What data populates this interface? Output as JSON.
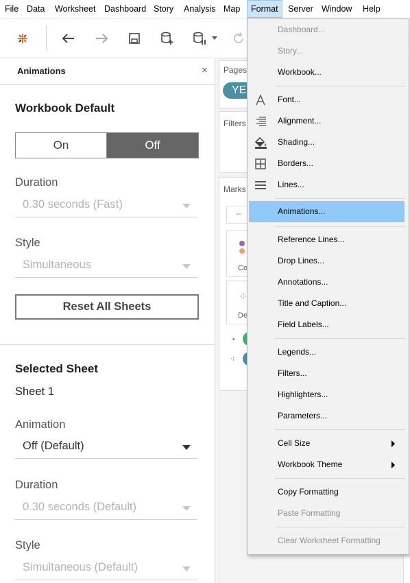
{
  "menubar": {
    "items": [
      {
        "label": "File"
      },
      {
        "label": "Data"
      },
      {
        "label": "Worksheet"
      },
      {
        "label": "Dashboard"
      },
      {
        "label": "Story"
      },
      {
        "label": "Analysis"
      },
      {
        "label": "Map"
      },
      {
        "label": "Format"
      },
      {
        "label": "Server"
      },
      {
        "label": "Window"
      },
      {
        "label": "Help"
      }
    ]
  },
  "toolbar": {
    "icons": [
      "tableau-logo-icon",
      "back-arrow-icon",
      "forward-arrow-icon",
      "save-icon",
      "new-datasource-icon",
      "pause-updates-icon",
      "dropdown-caret-icon",
      "refresh-icon"
    ]
  },
  "panel": {
    "title": "Animations",
    "close_glyph": "×",
    "workbook_default": {
      "heading": "Workbook Default",
      "toggle_on": "On",
      "toggle_off": "Off",
      "toggle_selected": "Off",
      "duration_label": "Duration",
      "duration_value": "0.30 seconds (Fast)",
      "style_label": "Style",
      "style_value": "Simultaneous",
      "reset_label": "Reset All Sheets"
    },
    "selected_sheet": {
      "heading": "Selected Sheet",
      "sheet_name": "Sheet 1",
      "animation_label": "Animation",
      "animation_value": "Off (Default)",
      "duration_label": "Duration",
      "duration_value": "0.30 seconds (Default)",
      "style_label": "Style",
      "style_value": "Simultaneous (Default)"
    }
  },
  "workspace": {
    "pages_title": "Pages",
    "pages_pill": "YE",
    "filters_title": "Filters",
    "marks_title": "Marks",
    "marks_color_label": "Co",
    "marks_detail_label": "De"
  },
  "format_menu": {
    "items": [
      {
        "label": "Dashboard...",
        "disabled": true
      },
      {
        "label": "Story...",
        "disabled": true
      },
      {
        "label": "Workbook...",
        "disabled": false
      },
      {
        "label": "Font...",
        "disabled": false,
        "icon": "font-icon"
      },
      {
        "label": "Alignment...",
        "disabled": false,
        "icon": "alignment-icon"
      },
      {
        "label": "Shading...",
        "disabled": false,
        "icon": "shading-icon"
      },
      {
        "label": "Borders...",
        "disabled": false,
        "icon": "borders-icon"
      },
      {
        "label": "Lines...",
        "disabled": false,
        "icon": "lines-icon"
      },
      {
        "label": "Animations...",
        "disabled": false,
        "highlighted": true
      },
      {
        "label": "Reference Lines...",
        "disabled": false
      },
      {
        "label": "Drop Lines...",
        "disabled": false
      },
      {
        "label": "Annotations...",
        "disabled": false
      },
      {
        "label": "Title and Caption...",
        "disabled": false
      },
      {
        "label": "Field Labels...",
        "disabled": false
      },
      {
        "label": "Legends...",
        "disabled": false
      },
      {
        "label": "Filters...",
        "disabled": false
      },
      {
        "label": "Highlighters...",
        "disabled": false
      },
      {
        "label": "Parameters...",
        "disabled": false
      },
      {
        "label": "Cell Size",
        "disabled": false,
        "submenu": true
      },
      {
        "label": "Workbook Theme",
        "disabled": false,
        "submenu": true
      },
      {
        "label": "Copy Formatting",
        "disabled": false
      },
      {
        "label": "Paste Formatting",
        "disabled": true
      },
      {
        "label": "Clear Worksheet Formatting",
        "disabled": true
      }
    ]
  },
  "colors": {
    "menu_highlight": "#91c9f7",
    "menubar_active": "#cce4f7",
    "toggle_selected_bg": "#666666",
    "pill_teal": "#4a90a4"
  }
}
